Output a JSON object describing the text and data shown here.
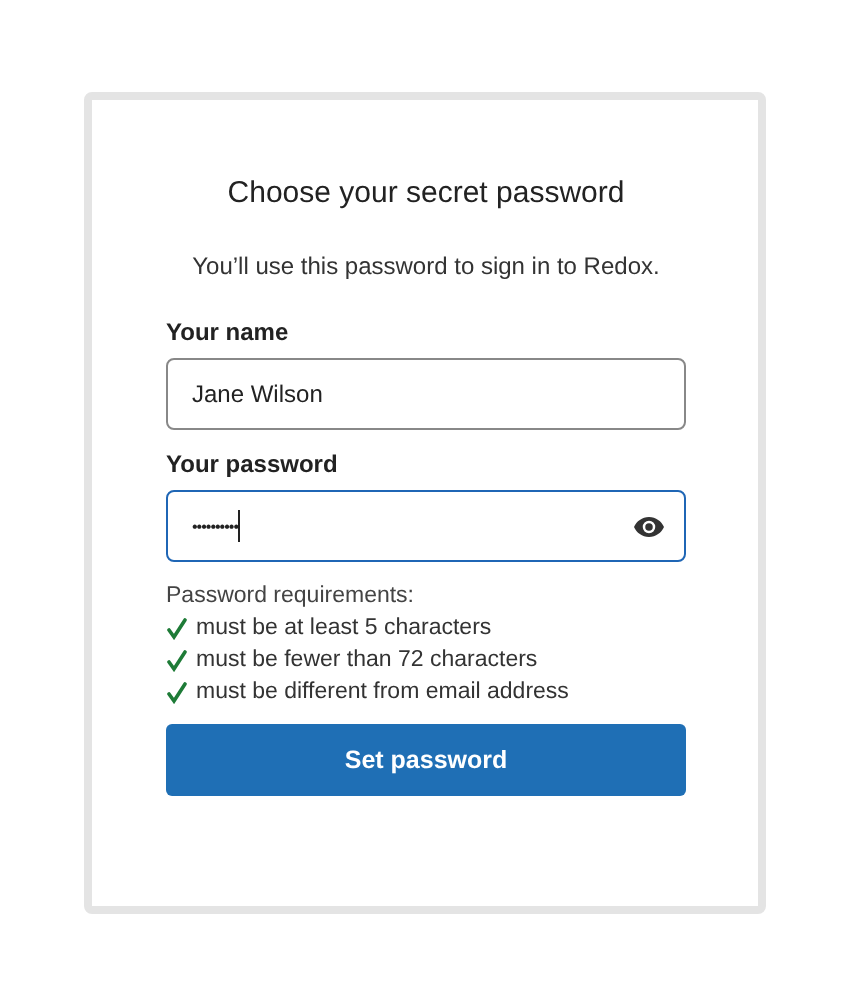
{
  "title": "Choose your secret password",
  "subtitle": "You’ll use this password to sign in to Redox.",
  "fields": [
    {
      "label": "Your name",
      "value": "Jane Wilson",
      "kind": "text",
      "focused": false
    },
    {
      "label": "Your password",
      "value": "••••••••••",
      "kind": "password",
      "focused": true
    }
  ],
  "requirements": {
    "heading": "Password requirements:",
    "items": [
      {
        "text": "must be at least 5 characters",
        "met": true
      },
      {
        "text": "must be fewer than 72 characters",
        "met": true
      },
      {
        "text": "must be different from email address",
        "met": true
      }
    ]
  },
  "submit": "Set password"
}
